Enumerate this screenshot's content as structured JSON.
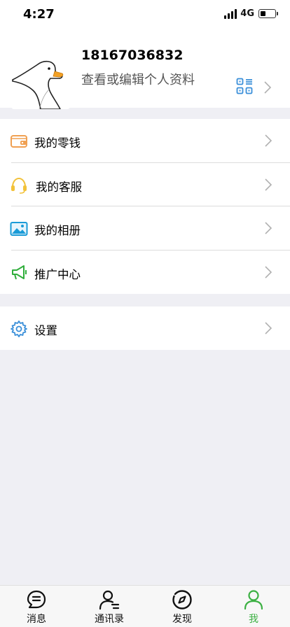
{
  "status_bar": {
    "time": "4:27",
    "network": "4G",
    "battery_level": 0.35
  },
  "profile": {
    "phone": "18167036832",
    "subtitle": "查看或编辑个人资料"
  },
  "menu": {
    "group1": [
      {
        "label": "我的零钱",
        "icon": "wallet-icon"
      },
      {
        "label": "我的客服",
        "icon": "headset-icon"
      },
      {
        "label": "我的相册",
        "icon": "album-icon"
      },
      {
        "label": "推广中心",
        "icon": "megaphone-icon"
      }
    ],
    "group2": [
      {
        "label": "设置",
        "icon": "gear-icon"
      }
    ]
  },
  "tabbar": {
    "items": [
      {
        "label": "消息",
        "icon": "chat-icon"
      },
      {
        "label": "通讯录",
        "icon": "contacts-icon"
      },
      {
        "label": "发现",
        "icon": "discover-icon"
      },
      {
        "label": "我",
        "icon": "person-icon"
      }
    ],
    "active_index": 3
  },
  "colors": {
    "accent": "#3cb043",
    "wallet": "#f0a052",
    "headset": "#f2c23a",
    "album": "#1a9bd7",
    "megaphone": "#2fae3b",
    "gear": "#3a8fd9"
  }
}
